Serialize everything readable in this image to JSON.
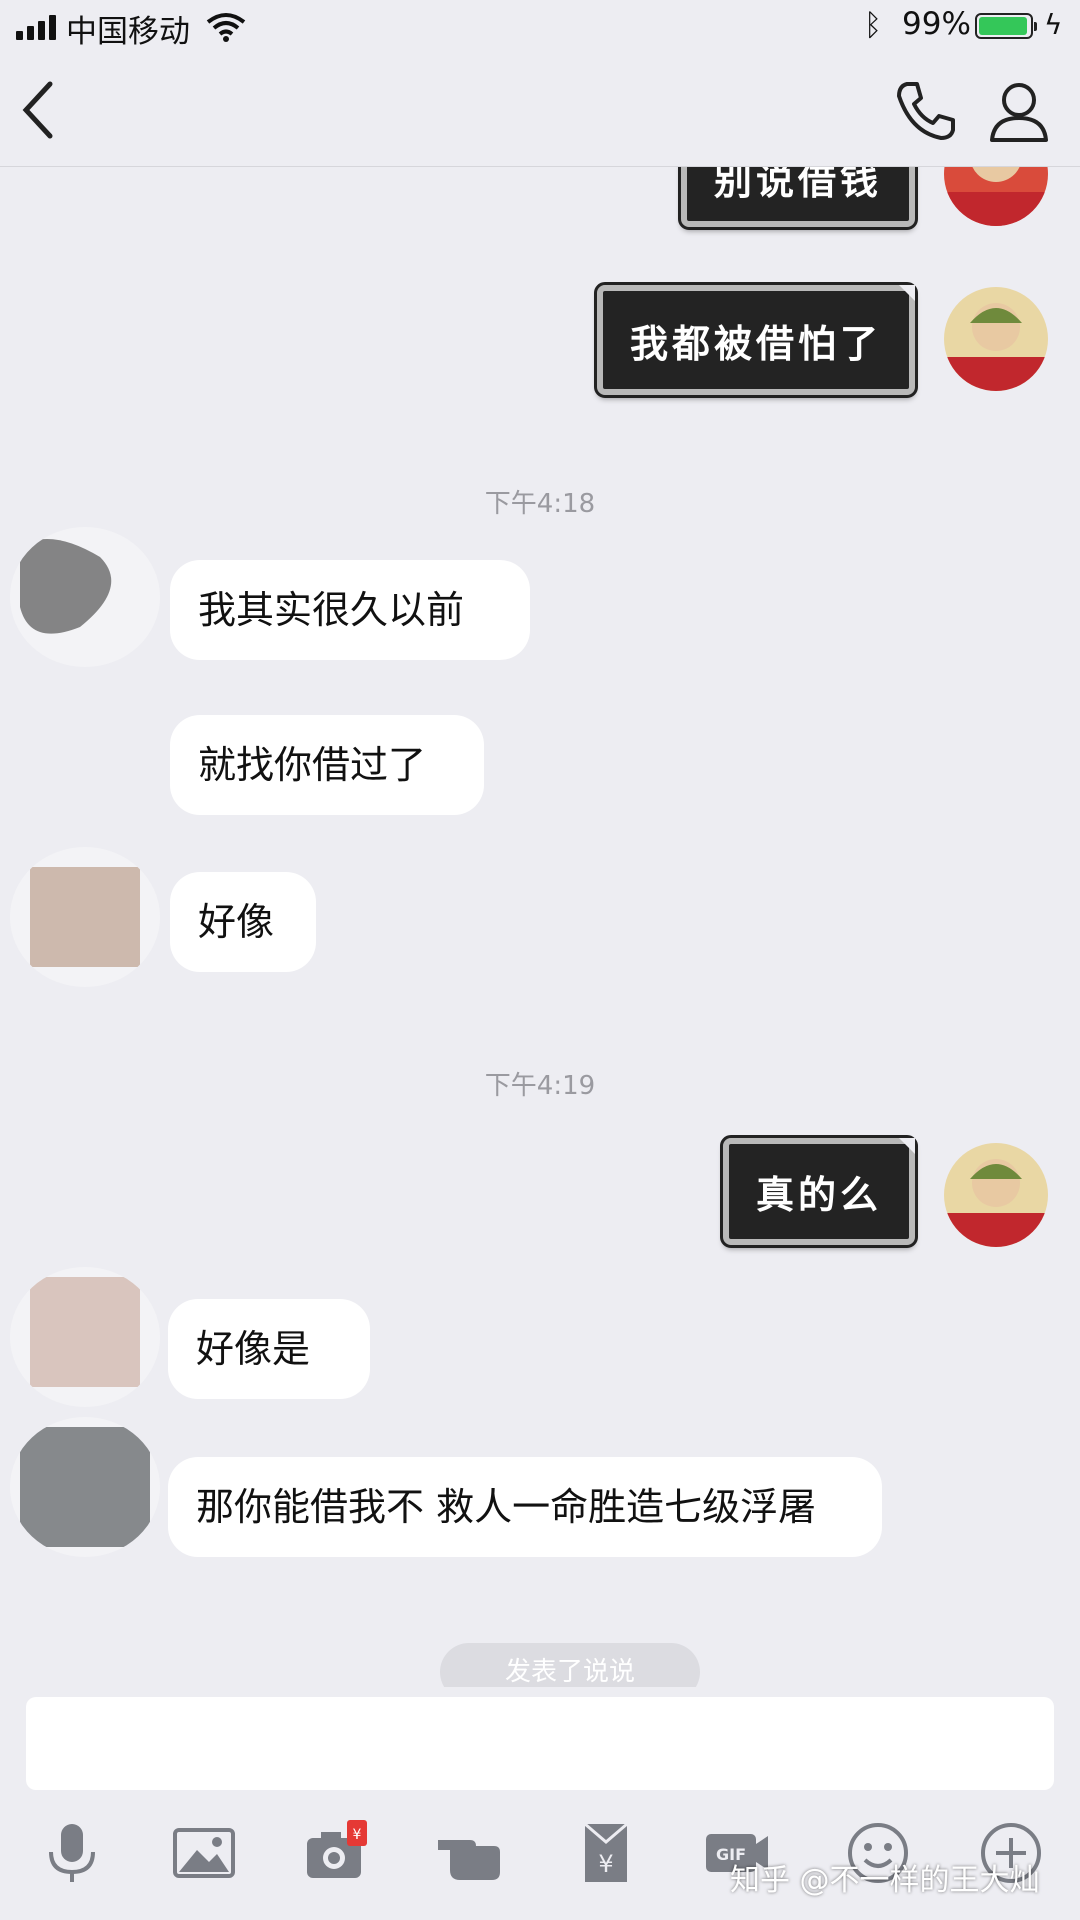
{
  "status_bar": {
    "carrier": "中国移动",
    "battery_percent": "99%",
    "battery_level": 0.99
  },
  "messages": [
    {
      "type": "sent_sticker",
      "text": "别说借钱"
    },
    {
      "type": "sent_sticker",
      "text": "我都被借怕了"
    },
    {
      "type": "time",
      "text": "下午4:18"
    },
    {
      "type": "received",
      "text": "我其实很久以前"
    },
    {
      "type": "received",
      "text": "就找你借过了"
    },
    {
      "type": "received",
      "text": "好像"
    },
    {
      "type": "time",
      "text": "下午4:19"
    },
    {
      "type": "sent_sticker",
      "text": "真的么"
    },
    {
      "type": "received",
      "text": "好像是"
    },
    {
      "type": "received",
      "text": "那你能借我不 救人一命胜造七级浮屠"
    },
    {
      "type": "system",
      "text": "发表了说说"
    }
  ],
  "toolbar_icons": [
    "mic-icon",
    "image-icon",
    "camera-icon",
    "hand-icon",
    "red-packet-icon",
    "gif-icon",
    "emoji-icon",
    "plus-icon"
  ],
  "watermark": "知乎 @不一样的王大灿",
  "colors": {
    "background": "#ededf2",
    "bubble": "#ffffff",
    "sticker": "#232323",
    "battery": "#34c759"
  }
}
